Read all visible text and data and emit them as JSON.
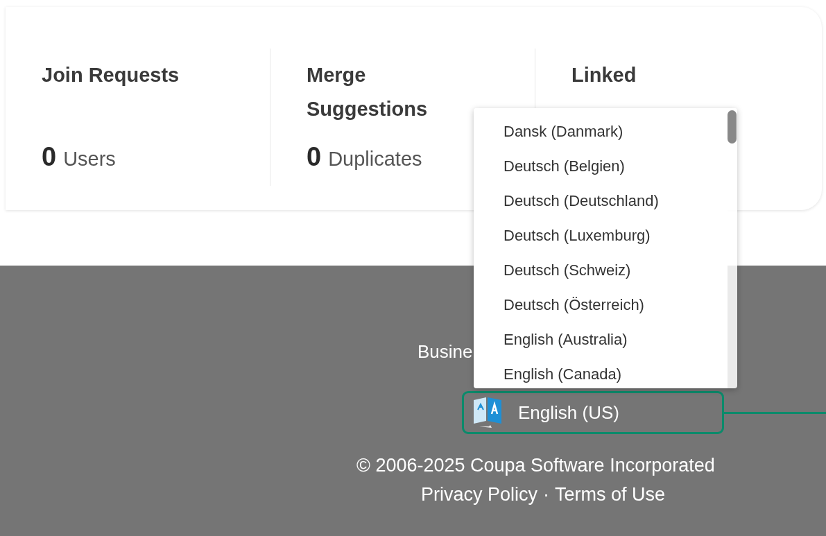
{
  "stats": [
    {
      "title": "Join Requests",
      "count": "0",
      "unit": "Users"
    },
    {
      "title": "Merge Suggestions",
      "count": "0",
      "unit": "Duplicates"
    },
    {
      "title": "Linked"
    }
  ],
  "footer": {
    "partial_line": "Busine",
    "language_selector": {
      "value": "English (US)",
      "expanded": true,
      "highlighted": true,
      "options": [
        "Dansk (Danmark)",
        "Deutsch (Belgien)",
        "Deutsch (Deutschland)",
        "Deutsch (Luxemburg)",
        "Deutsch (Schweiz)",
        "Deutsch (Österreich)",
        "English (Australia)",
        "English (Canada)"
      ]
    },
    "copyright": "© 2006-2025 Coupa Software Incorporated",
    "links": [
      {
        "label": "Privacy Policy"
      },
      {
        "label": "Terms of Use"
      }
    ],
    "link_separator": "·"
  }
}
